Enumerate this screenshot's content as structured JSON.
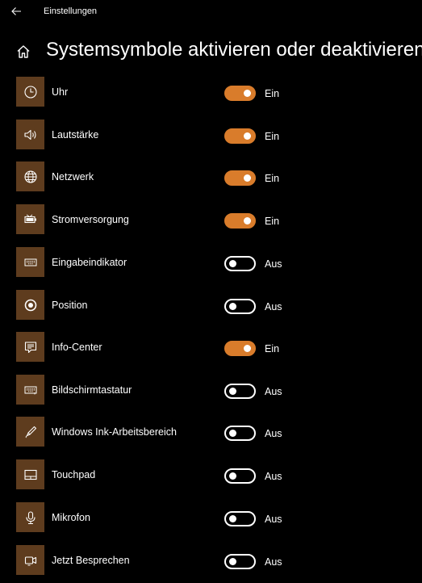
{
  "window": {
    "title": "Einstellungen",
    "back_icon": "back-arrow-icon"
  },
  "page": {
    "title": "Systemsymbole aktivieren oder deaktivieren",
    "home_icon": "home-icon"
  },
  "colors": {
    "background": "#000000",
    "tile": "#5e3c1e",
    "accent": "#d97c2b",
    "text": "#ffffff"
  },
  "items": [
    {
      "label": "Uhr",
      "icon": "clock-icon",
      "state_label": "Ein",
      "on": true
    },
    {
      "label": "Lautstärke",
      "icon": "volume-icon",
      "state_label": "Ein",
      "on": true
    },
    {
      "label": "Netzwerk",
      "icon": "globe-icon",
      "state_label": "Ein",
      "on": true
    },
    {
      "label": "Stromversorgung",
      "icon": "battery-icon",
      "state_label": "Ein",
      "on": true
    },
    {
      "label": "Eingabeindikator",
      "icon": "keyboard-icon",
      "state_label": "Aus",
      "on": false
    },
    {
      "label": "Position",
      "icon": "location-icon",
      "state_label": "Aus",
      "on": false
    },
    {
      "label": "Info-Center",
      "icon": "action-center-icon",
      "state_label": "Ein",
      "on": true
    },
    {
      "label": "Bildschirmtastatur",
      "icon": "touch-keyboard-icon",
      "state_label": "Aus",
      "on": false
    },
    {
      "label": "Windows Ink-Arbeitsbereich",
      "icon": "pen-icon",
      "state_label": "Aus",
      "on": false
    },
    {
      "label": "Touchpad",
      "icon": "touchpad-icon",
      "state_label": "Aus",
      "on": false
    },
    {
      "label": "Mikrofon",
      "icon": "microphone-icon",
      "state_label": "Aus",
      "on": false
    },
    {
      "label": "Jetzt Besprechen",
      "icon": "meet-now-icon",
      "state_label": "Aus",
      "on": false
    }
  ]
}
